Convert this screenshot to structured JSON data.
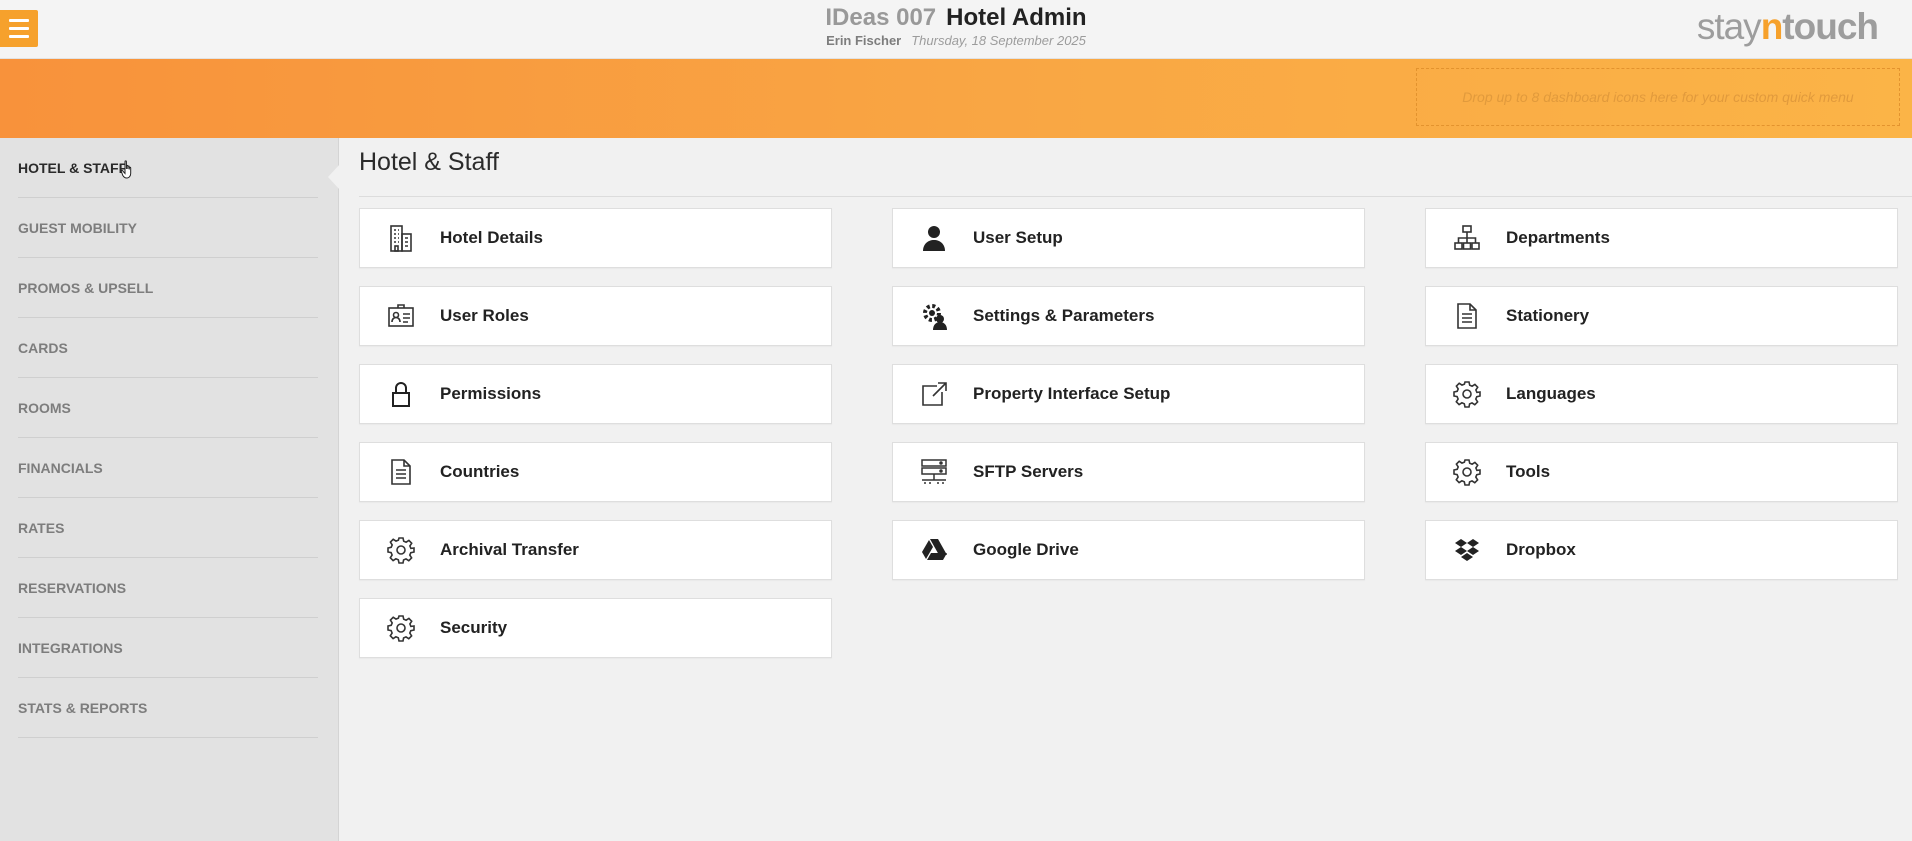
{
  "header": {
    "hotel_name": "IDeas 007",
    "app_title": "Hotel Admin",
    "user_name": "Erin Fischer",
    "date": "Thursday, 18 September 2025",
    "logo": {
      "part1": "stay",
      "part2": "n",
      "part3": "touch"
    },
    "brand_color": "#f6a12c"
  },
  "quick_menu": {
    "placeholder": "Drop up to 8 dashboard icons here for your custom quick menu"
  },
  "sidebar": {
    "items": [
      {
        "label": "HOTEL & STAFF",
        "active": true
      },
      {
        "label": "GUEST MOBILITY"
      },
      {
        "label": "PROMOS & UPSELL"
      },
      {
        "label": "CARDS"
      },
      {
        "label": "ROOMS"
      },
      {
        "label": "FINANCIALS"
      },
      {
        "label": "RATES"
      },
      {
        "label": "RESERVATIONS"
      },
      {
        "label": "INTEGRATIONS"
      },
      {
        "label": "STATS & REPORTS"
      }
    ]
  },
  "main": {
    "title": "Hotel & Staff",
    "cards": [
      {
        "label": "Hotel Details",
        "icon": "building-icon"
      },
      {
        "label": "User Setup",
        "icon": "user-icon"
      },
      {
        "label": "Departments",
        "icon": "org-chart-icon"
      },
      {
        "label": "User Roles",
        "icon": "id-card-icon"
      },
      {
        "label": "Settings & Parameters",
        "icon": "user-gear-icon"
      },
      {
        "label": "Stationery",
        "icon": "document-icon"
      },
      {
        "label": "Permissions",
        "icon": "lock-icon"
      },
      {
        "label": "Property Interface Setup",
        "icon": "external-link-icon"
      },
      {
        "label": "Languages",
        "icon": "gear-icon"
      },
      {
        "label": "Countries",
        "icon": "document-icon"
      },
      {
        "label": "SFTP Servers",
        "icon": "server-icon"
      },
      {
        "label": "Tools",
        "icon": "gear-icon"
      },
      {
        "label": "Archival Transfer",
        "icon": "gear-icon"
      },
      {
        "label": "Google Drive",
        "icon": "google-drive-icon"
      },
      {
        "label": "Dropbox",
        "icon": "dropbox-icon"
      },
      {
        "label": "Security",
        "icon": "gear-icon"
      }
    ]
  }
}
